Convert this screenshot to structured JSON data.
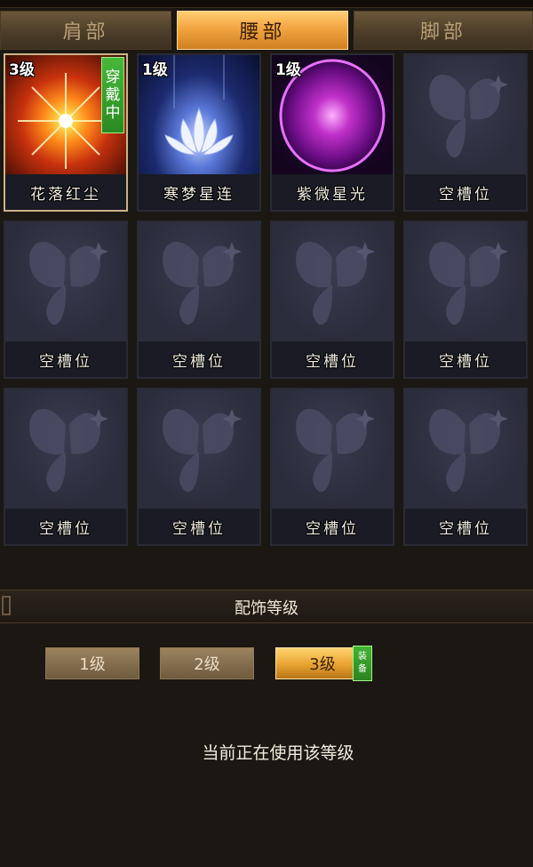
{
  "tabs": [
    {
      "label": "肩部",
      "active": false
    },
    {
      "label": "腰部",
      "active": true
    },
    {
      "label": "脚部",
      "active": false
    }
  ],
  "slots": [
    {
      "name": "花落红尘",
      "level": "3级",
      "wearing_label": "穿戴中",
      "icon": "sunburst-icon"
    },
    {
      "name": "寒梦星连",
      "level": "1级",
      "icon": "lotus-icon"
    },
    {
      "name": "紫微星光",
      "level": "1级",
      "icon": "purple-orb-icon"
    },
    {
      "name": "空槽位",
      "icon": "butterfly-icon"
    },
    {
      "name": "空槽位",
      "icon": "butterfly-icon"
    },
    {
      "name": "空槽位",
      "icon": "butterfly-icon"
    },
    {
      "name": "空槽位",
      "icon": "butterfly-icon"
    },
    {
      "name": "空槽位",
      "icon": "butterfly-icon"
    },
    {
      "name": "空槽位",
      "icon": "butterfly-icon"
    },
    {
      "name": "空槽位",
      "icon": "butterfly-icon"
    },
    {
      "name": "空槽位",
      "icon": "butterfly-icon"
    },
    {
      "name": "空槽位",
      "icon": "butterfly-icon"
    }
  ],
  "section": {
    "title": "配饰等级"
  },
  "levels": [
    {
      "label": "1级",
      "active": false
    },
    {
      "label": "2级",
      "active": false
    },
    {
      "label": "3级",
      "active": true
    }
  ],
  "equip_badge": "装备",
  "status": "当前正在使用该等级",
  "colors": {
    "active_tab": "#f2a541",
    "wearing_badge": "#2a8a22",
    "slot_bg": "#2c2d3d",
    "panel_bg": "#1b1712"
  }
}
